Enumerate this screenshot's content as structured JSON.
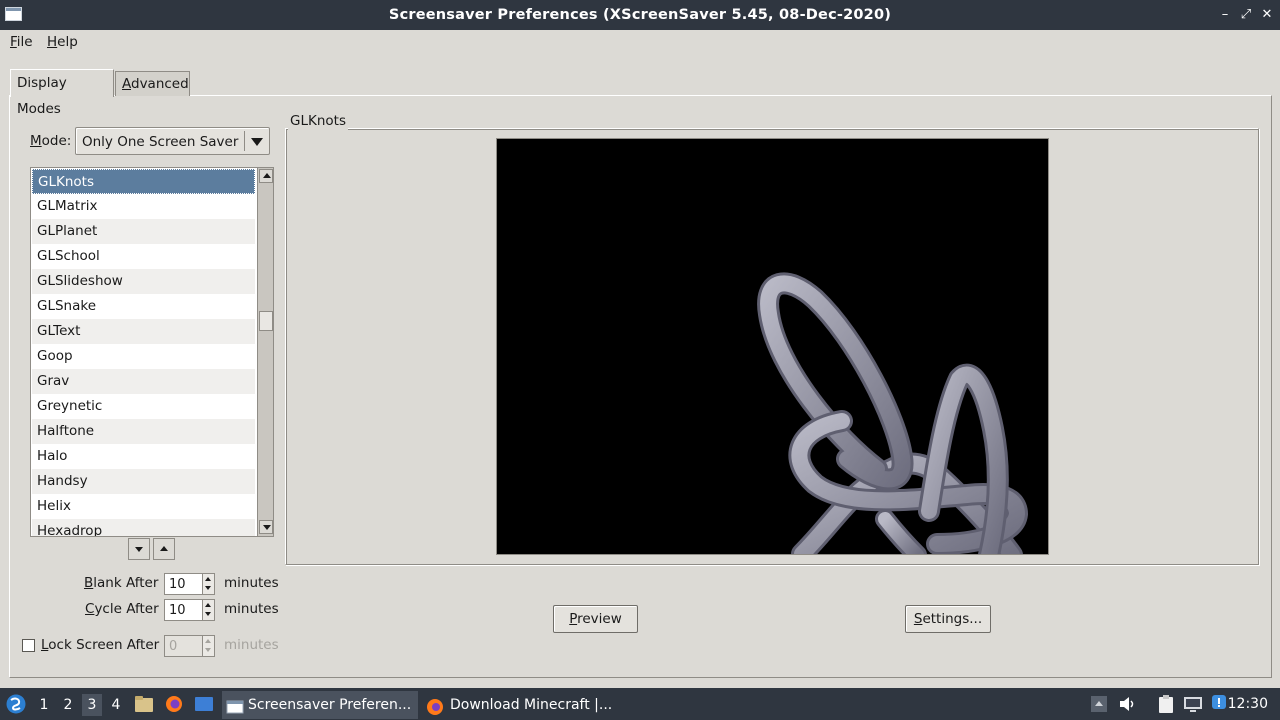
{
  "window": {
    "title": "Screensaver Preferences  (XScreenSaver 5.45, 08-Dec-2020)",
    "minimize_glyph": "–",
    "maximize_glyph": "⤢",
    "close_glyph": "✕"
  },
  "menubar": {
    "file": "File",
    "help": "Help"
  },
  "tabs": {
    "display_modes": "Display Modes",
    "advanced": "Advanced"
  },
  "mode": {
    "label": "Mode:",
    "value": "Only One Screen Saver"
  },
  "list": {
    "items": [
      "GLKnots",
      "GLMatrix",
      "GLPlanet",
      "GLSchool",
      "GLSlideshow",
      "GLSnake",
      "GLText",
      "Goop",
      "Grav",
      "Greynetic",
      "Halftone",
      "Halo",
      "Handsy",
      "Helix",
      "Hexadrop"
    ],
    "selected": "GLKnots"
  },
  "timing": {
    "blank_label": "Blank After",
    "blank_value": "10",
    "cycle_label": "Cycle After",
    "cycle_value": "10",
    "lock_label": "Lock Screen After",
    "lock_value": "0",
    "unit": "minutes"
  },
  "preview": {
    "frame_title": "GLKnots",
    "preview_button": "Preview",
    "settings_button": "Settings..."
  },
  "taskbar": {
    "workspaces": [
      "1",
      "2",
      "3",
      "4"
    ],
    "active_workspace": "3",
    "tasks": [
      "Screensaver Preferen...",
      "Download Minecraft |..."
    ],
    "clock": "12:30"
  },
  "colors": {
    "titlebar": "#2f3640",
    "window_bg": "#dcdad5",
    "selection": "#5c7d9e",
    "preview_bg": "#000000",
    "knot": "#8a8a99"
  }
}
